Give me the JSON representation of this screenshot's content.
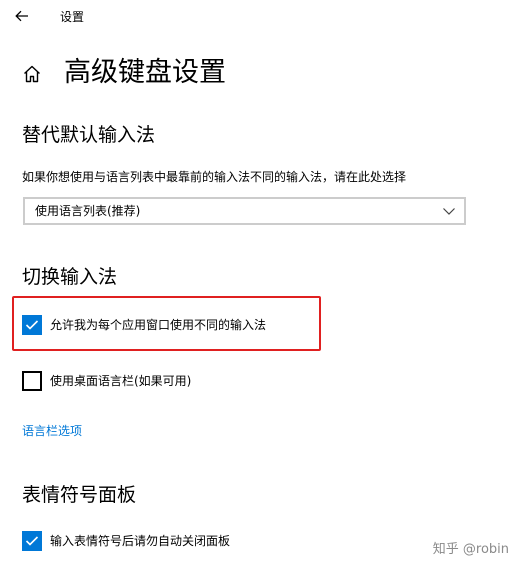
{
  "window": {
    "title": "设置",
    "back_icon": "arrow-left-icon"
  },
  "page": {
    "title": "高级键盘设置",
    "home_icon": "home-icon"
  },
  "override_input": {
    "heading": "替代默认输入法",
    "description": "如果你想使用与语言列表中最靠前的输入法不同的输入法，请在此处选择",
    "dropdown": {
      "selected": "使用语言列表(推荐)",
      "icon": "chevron-down-icon"
    }
  },
  "switch_input": {
    "heading": "切换输入法",
    "per_app_checkbox": {
      "label": "允许我为每个应用窗口使用不同的输入法",
      "checked": true
    },
    "desktop_bar_checkbox": {
      "label": "使用桌面语言栏(如果可用)",
      "checked": false
    },
    "language_bar_link": "语言栏选项"
  },
  "emoji_panel": {
    "heading": "表情符号面板",
    "auto_close_checkbox": {
      "label": "输入表情符号后请勿自动关闭面板",
      "checked": true
    }
  },
  "colors": {
    "accent": "#0078d7",
    "highlight_border": "#e02020"
  },
  "watermark": "知乎 @robin"
}
